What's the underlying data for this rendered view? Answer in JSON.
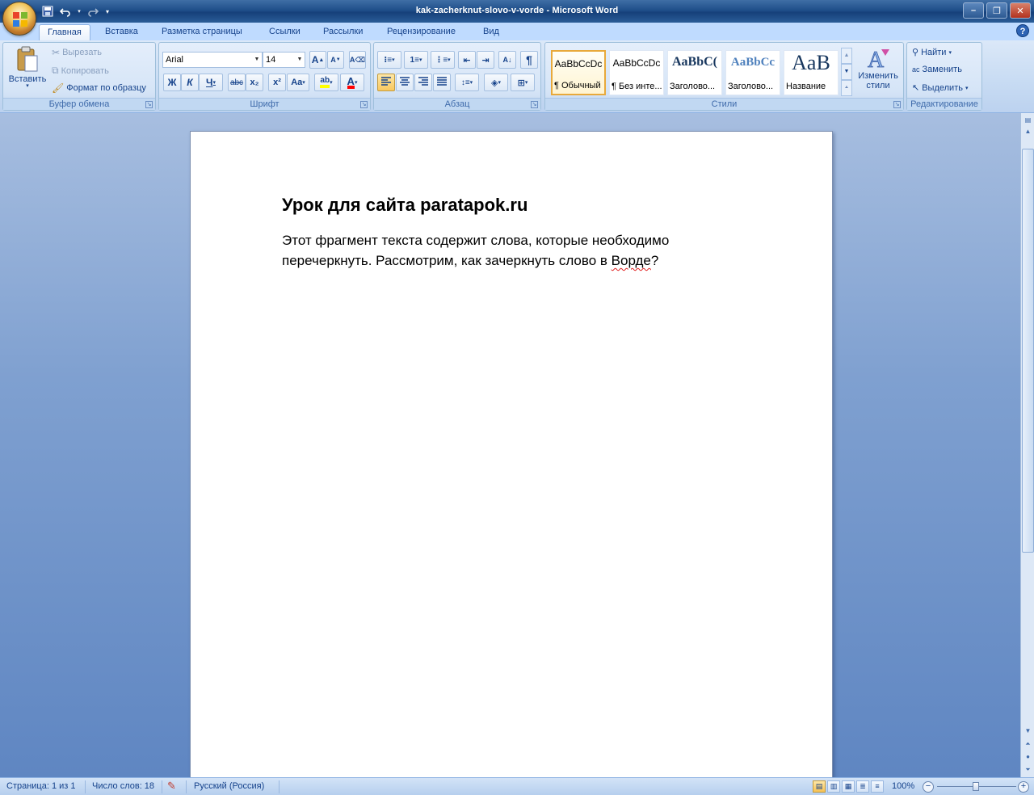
{
  "window": {
    "doc_name": "kak-zacherknut-slovo-v-vorde",
    "separator": " - ",
    "app_name": "Microsoft Word"
  },
  "tabs": [
    "Главная",
    "Вставка",
    "Разметка страницы",
    "Ссылки",
    "Рассылки",
    "Рецензирование",
    "Вид"
  ],
  "ribbon": {
    "clipboard": {
      "title": "Буфер обмена",
      "paste": "Вставить",
      "cut": "Вырезать",
      "copy": "Копировать",
      "format_painter": "Формат по образцу"
    },
    "font": {
      "title": "Шрифт",
      "font_name": "Arial",
      "font_size": "14",
      "bold": "Ж",
      "italic": "К",
      "underline": "Ч",
      "strike": "abc",
      "subscript": "x₂",
      "superscript": "x²",
      "change_case": "Aa",
      "grow": "A",
      "shrink": "A"
    },
    "paragraph": {
      "title": "Абзац",
      "pilcrow": "¶"
    },
    "styles": {
      "title": "Стили",
      "items": [
        {
          "sample": "AaBbCcDc",
          "name": "¶ Обычный"
        },
        {
          "sample": "AaBbCcDc",
          "name": "¶ Без инте..."
        },
        {
          "sample": "AaBbC(",
          "name": "Заголово..."
        },
        {
          "sample": "AaBbCc",
          "name": "Заголово..."
        },
        {
          "sample": "AaB",
          "name": "Название"
        }
      ],
      "change_styles": "Изменить стили"
    },
    "editing": {
      "title": "Редактирование",
      "find": "Найти",
      "replace": "Заменить",
      "select": "Выделить"
    }
  },
  "document": {
    "heading": "Урок для сайта paratapok.ru",
    "body_part1": "Этот фрагмент текста содержит слова, которые необходимо перечеркнуть. Рассмотрим, как зачеркнуть слово в ",
    "body_misspelled": "Ворде",
    "body_part2": "?"
  },
  "status": {
    "page": "Страница: 1 из 1",
    "words": "Число слов: 18",
    "language": "Русский (Россия)",
    "zoom": "100%"
  },
  "colors": {
    "ribbon_bg": "#c7dbf3",
    "tab_active": "#ffffff",
    "text": "#15428b",
    "title_bar": "#1f4f8a",
    "highlight": "#ffff00",
    "font_color": "#ff0000"
  }
}
